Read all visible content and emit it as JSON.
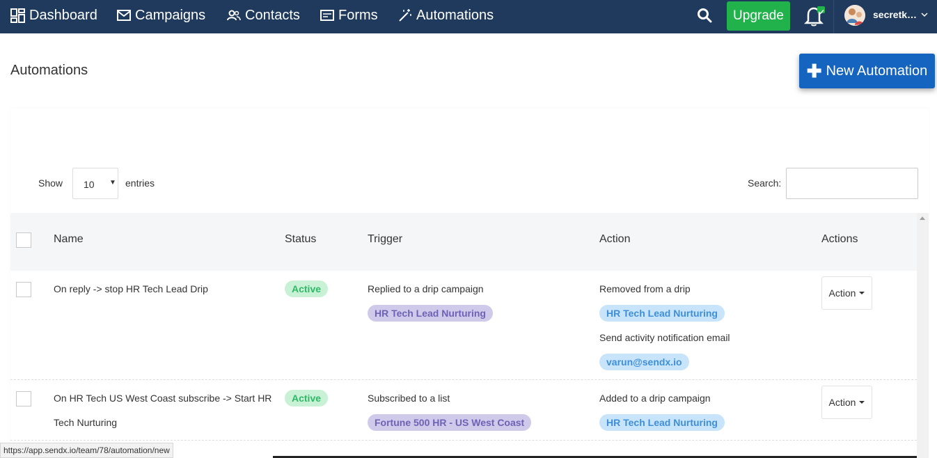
{
  "nav": {
    "items": [
      {
        "key": "dashboard",
        "label": "Dashboard",
        "icon": "dashboard-icon"
      },
      {
        "key": "campaigns",
        "label": "Campaigns",
        "icon": "mail-icon"
      },
      {
        "key": "contacts",
        "label": "Contacts",
        "icon": "contacts-icon"
      },
      {
        "key": "forms",
        "label": "Forms",
        "icon": "forms-icon"
      },
      {
        "key": "automations",
        "label": "Automations",
        "icon": "magic-wand-icon"
      }
    ],
    "upgrade_label": "Upgrade",
    "user_name": "secretkeeper",
    "colors": {
      "bar": "#1f3a5c",
      "upgrade": "#22b24c"
    }
  },
  "page": {
    "title": "Automations",
    "new_button_label": "New Automation"
  },
  "table_controls": {
    "show_label": "Show",
    "entries_value": "10",
    "entries_label": "entries",
    "search_label": "Search:",
    "search_value": ""
  },
  "table": {
    "headers": {
      "name": "Name",
      "status": "Status",
      "trigger": "Trigger",
      "action": "Action",
      "actions": "Actions"
    },
    "rows": [
      {
        "name_line1": "On reply -> stop HR Tech Lead Drip",
        "name_line2": "",
        "status": "Active",
        "trigger_text": "Replied to a drip campaign",
        "trigger_tag": "HR Tech Lead Nurturing",
        "action_text": "Removed from a drip",
        "action_tag": "HR Tech Lead Nurturing",
        "action_text2": "Send activity notification email",
        "action_tag2": "varun@sendx.io",
        "action_button": "Action"
      },
      {
        "name_line1": "On HR Tech US West Coast subscribe -> Start HR",
        "name_line2": "Tech Nurturing",
        "status": "Active",
        "trigger_text": "Subscribed to a list",
        "trigger_tag": "Fortune 500 HR - US West Coast",
        "action_text": "Added to a drip campaign",
        "action_tag": "HR Tech Lead Nurturing",
        "action_button": "Action"
      }
    ]
  },
  "status_bar": {
    "url": "https://app.sendx.io/team/78/automation/new"
  }
}
